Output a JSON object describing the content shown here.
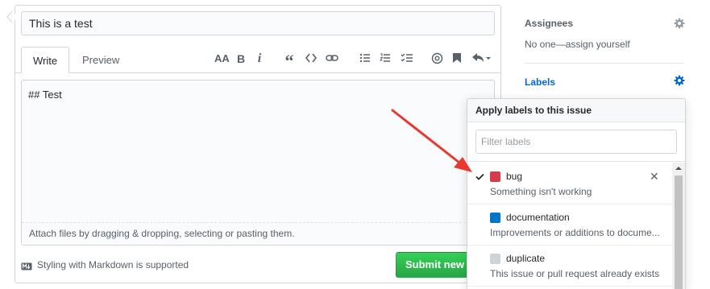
{
  "form": {
    "title_value": "This is a test",
    "tabs": [
      {
        "label": "Write",
        "active": true
      },
      {
        "label": "Preview",
        "active": false
      }
    ],
    "toolbar": {
      "header_label": "AA",
      "bold_label": "B",
      "italic_label": "i",
      "quote_label": "“"
    },
    "editor_value": "## Test",
    "attach_text": "Attach files by dragging & dropping, selecting or pasting them.",
    "markdown_note": "Styling with Markdown is supported",
    "submit_label": "Submit new issue"
  },
  "sidebar": {
    "assignees": {
      "heading": "Assignees",
      "value": "No one—assign yourself"
    },
    "labels": {
      "heading": "Labels"
    }
  },
  "label_popover": {
    "header": "Apply labels to this issue",
    "filter_placeholder": "Filter labels",
    "items": [
      {
        "name": "bug",
        "description": "Something isn't working",
        "color": "#d73a4a",
        "selected": true
      },
      {
        "name": "documentation",
        "description": "Improvements or additions to docume...",
        "color": "#0075ca",
        "selected": false
      },
      {
        "name": "duplicate",
        "description": "This issue or pull request already exists",
        "color": "#cfd3d7",
        "selected": false
      }
    ]
  },
  "colors": {
    "accent": "#0366d6",
    "submit_green": "#28a745",
    "annotation_red": "#e8382f"
  }
}
